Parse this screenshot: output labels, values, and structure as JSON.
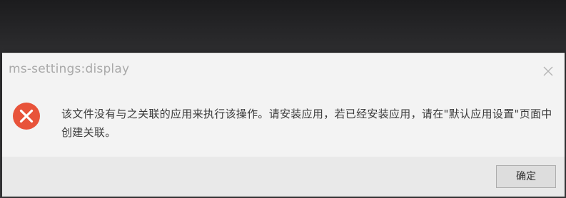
{
  "dialog": {
    "title": "ms-settings:display",
    "message": "该文件没有与之关联的应用来执行该操作。请安装应用，若已经安装应用，请在\"默认应用设置\"页面中创建关联。",
    "ok_label": "确定"
  },
  "icons": {
    "error": "error-circle-x-icon",
    "close": "close-icon"
  },
  "colors": {
    "error_red": "#e8533a",
    "dialog_bg": "#f3f3f3",
    "footer_bg": "#e9e9e9"
  }
}
